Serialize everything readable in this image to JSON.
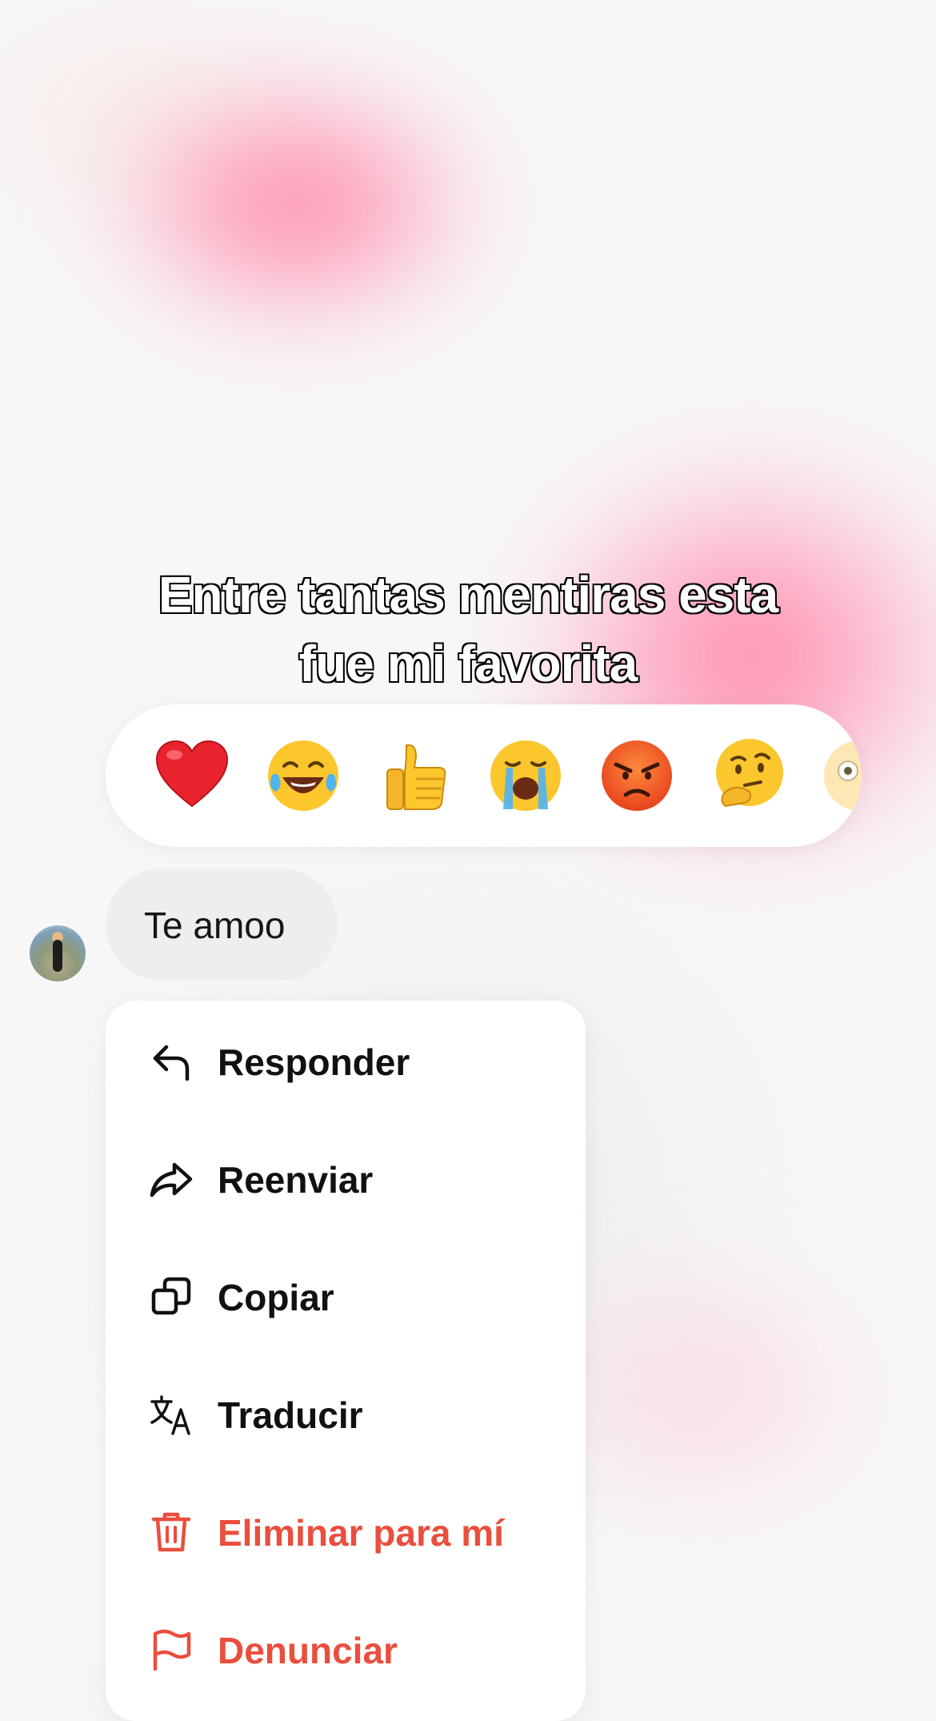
{
  "caption": {
    "line1": "Entre tantas mentiras esta",
    "line2": "fue mi favorita"
  },
  "reactions": [
    {
      "name": "heart",
      "glyph": "❤️"
    },
    {
      "name": "tears-of-joy",
      "glyph": "😂"
    },
    {
      "name": "thumbs-up",
      "glyph": "👍"
    },
    {
      "name": "crying",
      "glyph": "😭"
    },
    {
      "name": "angry",
      "glyph": "😡"
    },
    {
      "name": "thinking",
      "glyph": "🤔"
    },
    {
      "name": "surprised",
      "glyph": "😳"
    }
  ],
  "message": {
    "text": "Te amoo"
  },
  "menu": {
    "items": [
      {
        "label": "Responder",
        "icon": "reply-icon",
        "color": "#111111"
      },
      {
        "label": "Reenviar",
        "icon": "forward-icon",
        "color": "#111111"
      },
      {
        "label": "Copiar",
        "icon": "copy-icon",
        "color": "#111111"
      },
      {
        "label": "Traducir",
        "icon": "translate-icon",
        "color": "#111111"
      },
      {
        "label": "Eliminar para mí",
        "icon": "trash-icon",
        "color": "#ea4e3d"
      },
      {
        "label": "Denunciar",
        "icon": "flag-icon",
        "color": "#ea4e3d"
      }
    ]
  },
  "colors": {
    "danger": "#ea4e3d",
    "bubble": "#efeeef",
    "accent_blob": "#ff7fa0"
  }
}
